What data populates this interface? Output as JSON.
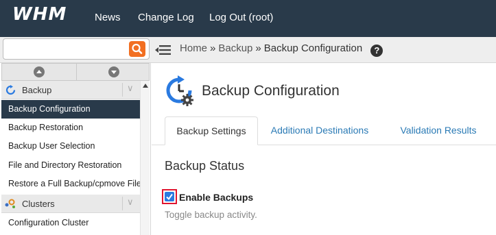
{
  "header": {
    "logo": "WHM",
    "nav": [
      "News",
      "Change Log",
      "Log Out (root)"
    ]
  },
  "search": {
    "value": "",
    "placeholder": ""
  },
  "breadcrumb": {
    "items": [
      "Home",
      "Backup"
    ],
    "separator": "»",
    "current": "Backup Configuration"
  },
  "sidebar": {
    "groups": [
      {
        "label": "Backup",
        "items": [
          "Backup Configuration",
          "Backup Restoration",
          "Backup User Selection",
          "File and Directory Restoration",
          "Restore a Full Backup/cpmove File"
        ]
      },
      {
        "label": "Clusters",
        "items": [
          "Configuration Cluster"
        ]
      }
    ],
    "active_item": "Backup Configuration"
  },
  "main": {
    "title": "Backup Configuration",
    "tabs": [
      "Backup Settings",
      "Additional Destinations",
      "Validation Results"
    ],
    "active_tab": "Backup Settings",
    "section_title": "Backup Status",
    "enable_backups": {
      "label": "Enable Backups",
      "checked": true,
      "help": "Toggle backup activity."
    }
  },
  "colors": {
    "header_bg": "#293a4a",
    "active_item_bg": "#293a4a",
    "accent_orange": "#f26f21",
    "link_blue": "#2a7ab5",
    "checkbox_blue": "#2a7ae0",
    "highlight_red": "#e0142f"
  }
}
